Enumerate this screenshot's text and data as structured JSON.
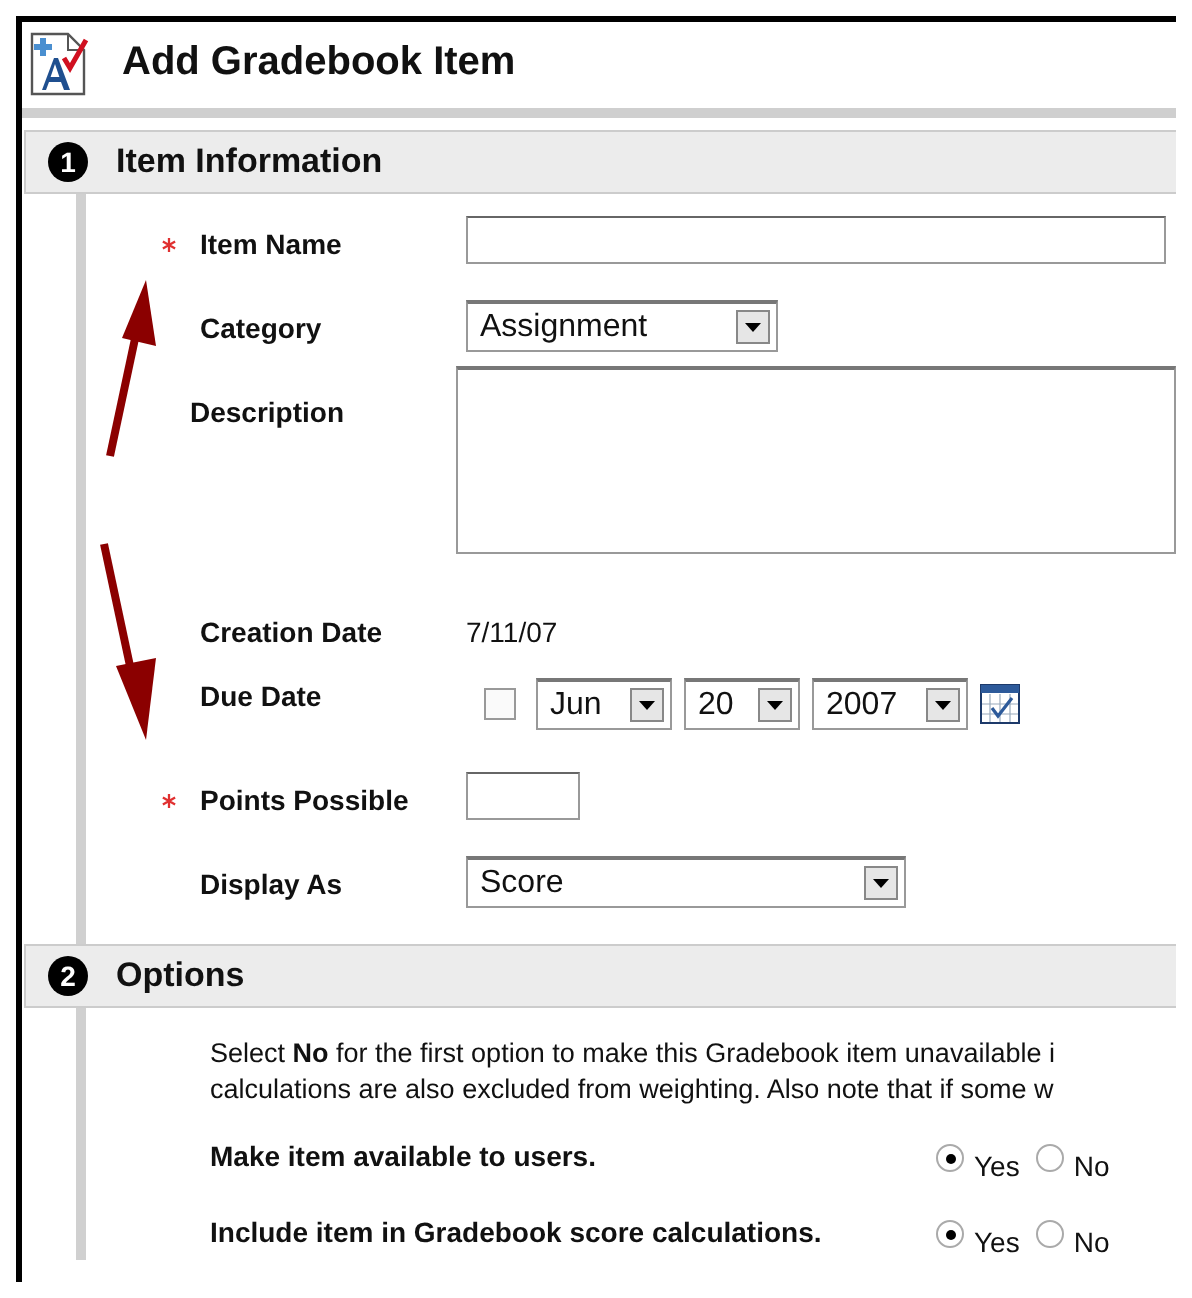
{
  "header": {
    "title": "Add Gradebook Item"
  },
  "sections": [
    {
      "number": "1",
      "title": "Item Information",
      "fields": [
        {
          "kind": "text",
          "label": "Item Name",
          "required": true
        },
        {
          "kind": "select",
          "label": "Category",
          "required": false,
          "value": "Assignment"
        },
        {
          "kind": "textarea",
          "label": "Description",
          "required": false
        },
        {
          "kind": "static",
          "label": "Creation Date",
          "required": false,
          "value": "7/11/07"
        },
        {
          "kind": "date",
          "label": "Due Date",
          "required": false,
          "checked": false,
          "month": "Jun",
          "day": "20",
          "year": "2007"
        },
        {
          "kind": "number",
          "label": "Points Possible",
          "required": true
        },
        {
          "kind": "wideselect",
          "label": "Display As",
          "required": false,
          "value": "Score"
        }
      ]
    },
    {
      "number": "2",
      "title": "Options",
      "lines": [
        "Select **No** for the first option to make this Gradebook item unavailable i",
        "calculations are also excluded from weighting. Also note that if some w"
      ],
      "options": [
        {
          "label": "Make item available to users.",
          "choices": [
            {
              "label": "Yes",
              "selected": true
            },
            {
              "label": "No",
              "selected": false
            }
          ]
        },
        {
          "label": "Include item in Gradebook score calculations.",
          "choices": [
            {
              "label": "Yes",
              "selected": true
            },
            {
              "label": "No",
              "selected": false
            }
          ]
        }
      ]
    }
  ]
}
